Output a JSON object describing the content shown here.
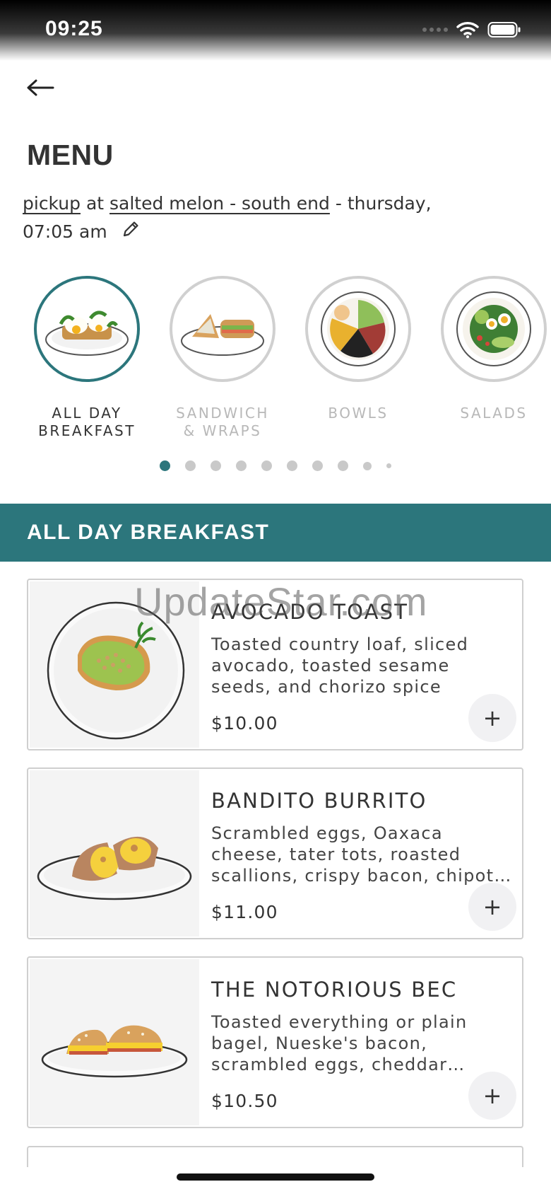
{
  "status_bar": {
    "time": "09:25"
  },
  "header": {
    "title": "MENU"
  },
  "pickup": {
    "mode": "pickup",
    "at": "at",
    "location": "salted melon - south end",
    "when": "- thursday, 07:05 am"
  },
  "categories": [
    {
      "label": "ALL DAY\nBREAKFAST",
      "active": true
    },
    {
      "label": "SANDWICH\n& WRAPS",
      "active": false
    },
    {
      "label": "BOWLS",
      "active": false
    },
    {
      "label": "SALADS",
      "active": false
    }
  ],
  "pagination": {
    "total": 10,
    "current": 1
  },
  "section": {
    "title": "ALL DAY BREAKFAST"
  },
  "items": [
    {
      "name": "AVOCADO TOAST",
      "description": "Toasted country loaf, sliced avocado, toasted sesame seeds, and chorizo spice",
      "price": "$10.00",
      "add_label": "+"
    },
    {
      "name": "BANDITO BURRITO",
      "description": "Scrambled eggs, Oaxaca cheese, tater tots, roasted scallions, crispy bacon, chipotle aioli",
      "price": "$11.00",
      "add_label": "+"
    },
    {
      "name": "THE NOTORIOUS BEC",
      "description": "Toasted everything or plain bagel, Nueske's bacon, scrambled eggs, cheddar cheese",
      "price": "$10.50",
      "add_label": "+"
    }
  ],
  "watermark": "UpdateStar.com",
  "colors": {
    "accent": "#2c767c",
    "inactive": "#c9c9c9"
  },
  "icons": {
    "back": "arrow-left-icon",
    "edit": "pencil-icon",
    "add": "plus-icon"
  }
}
